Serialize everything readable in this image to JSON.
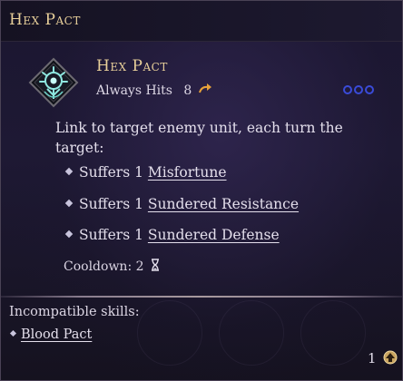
{
  "header": {
    "title": "Hex Pact"
  },
  "skill": {
    "name": "Hex Pact",
    "icon": "hex-sigil-icon",
    "accuracy_label": "Always Hits",
    "cost_value": "8",
    "cost_icon": "arrow-turn-icon",
    "description": "Link to target enemy unit, each turn the target:",
    "effects": [
      {
        "prefix": "Suffers 1",
        "link": "Misfortune"
      },
      {
        "prefix": "Suffers 1",
        "link": "Sundered Resistance"
      },
      {
        "prefix": "Suffers 1",
        "link": "Sundered Defense"
      }
    ],
    "cooldown_label": "Cooldown: 2",
    "cooldown_icon": "hourglass-icon"
  },
  "incompatible": {
    "title": "Incompatible skills:",
    "items": [
      "Blood Pact"
    ]
  },
  "slot": {
    "count": "1",
    "icon": "upgrade-arrow-icon"
  },
  "colors": {
    "title_gold": "#e8cf9a",
    "text": "#e4dfec",
    "dots_blue": "#3a4bd8",
    "icon_cyan": "#8fe8e0",
    "cost_orange": "#e8a23a"
  }
}
